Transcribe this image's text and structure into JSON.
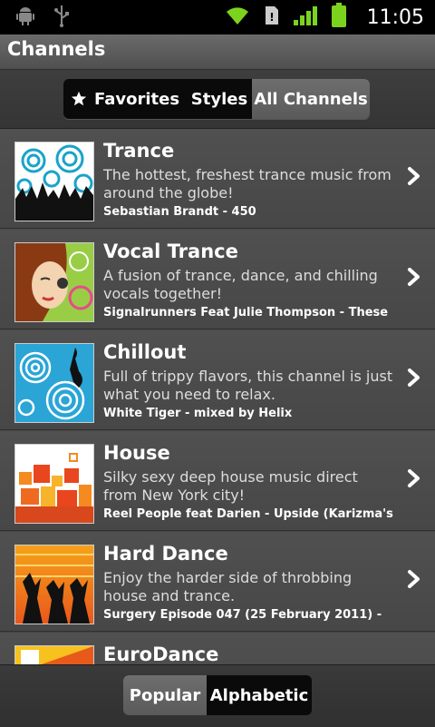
{
  "status_bar": {
    "time": "11:05",
    "icons": [
      "android-debug-icon",
      "usb-icon",
      "wifi-icon",
      "sd-card-icon",
      "signal-icon",
      "battery-icon"
    ]
  },
  "app": {
    "title": "Channels"
  },
  "top_tabs": [
    {
      "label": "Favorites",
      "icon": "star-icon",
      "active": false
    },
    {
      "label": "Styles",
      "active": false
    },
    {
      "label": "All Channels",
      "active": true
    }
  ],
  "channels": [
    {
      "title": "Trance",
      "description": "The hottest, freshest trance music from around the globe!",
      "now_playing": "Sebastian Brandt - 450"
    },
    {
      "title": "Vocal Trance",
      "description": "A fusion of trance, dance, and chilling vocals together!",
      "now_playing": "Signalrunners Feat Julie Thompson - These"
    },
    {
      "title": "Chillout",
      "description": "Full of trippy flavors, this channel is just what you need to relax.",
      "now_playing": "White Tiger - mixed by Helix"
    },
    {
      "title": "House",
      "description": "Silky sexy deep house music direct from New York city!",
      "now_playing": "Reel People feat Darien - Upside (Karizma's"
    },
    {
      "title": "Hard Dance",
      "description": "Enjoy the harder side of throbbing house and trance.",
      "now_playing": "Surgery Episode 047 (25 February 2011) -"
    },
    {
      "title": "EuroDance",
      "description": "",
      "now_playing": ""
    }
  ],
  "bottom_tabs": [
    {
      "label": "Popular",
      "active": true
    },
    {
      "label": "Alphabetic",
      "active": false
    }
  ]
}
